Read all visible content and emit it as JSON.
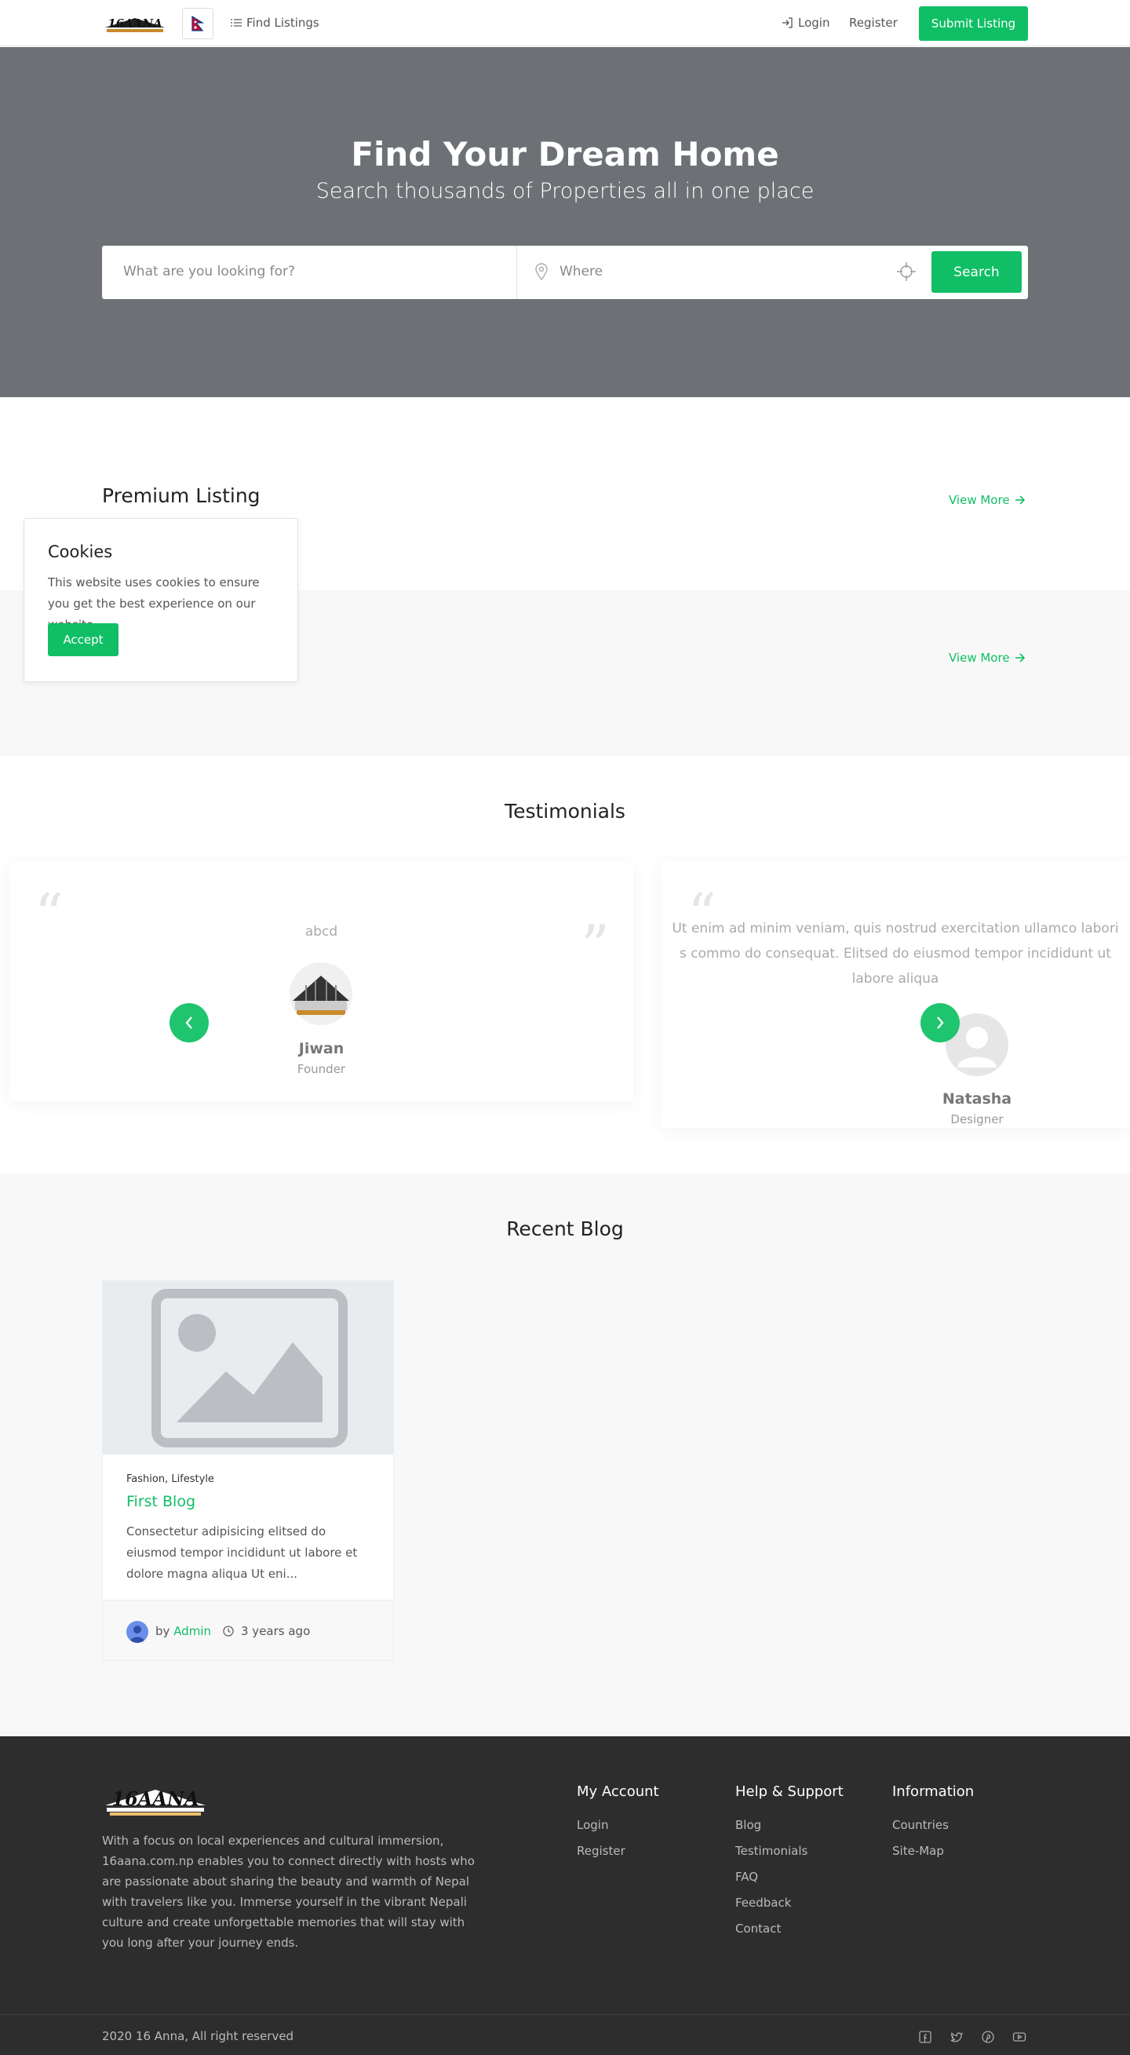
{
  "header": {
    "find_listings": "Find Listings",
    "login": "Login",
    "register": "Register",
    "submit_listing": "Submit Listing"
  },
  "hero": {
    "title": "Find Your Dream Home",
    "subtitle": "Search thousands of Properties all in one place",
    "search_placeholder": "What are you looking for?",
    "where_placeholder": "Where",
    "search_button": "Search"
  },
  "premium": {
    "title": "Premium Listing",
    "view_more": "View More"
  },
  "second_section": {
    "view_more": "View More"
  },
  "cookie": {
    "title": "Cookies",
    "text": "This website uses cookies to ensure you get the best experience on our website.",
    "accept": "Accept"
  },
  "testimonials": {
    "title": "Testimonials",
    "items": [
      {
        "text": "abcd",
        "name": "Jiwan",
        "role": "Founder"
      },
      {
        "text": "Ut enim ad minim veniam, quis nostrud exerc​itation ullamco labori​s commo do consequat. Elitsed do eiusmod tempor incididunt ut labore aliqua",
        "name": "Natasha",
        "role": "Designer"
      }
    ]
  },
  "blog": {
    "title": "Recent Blog",
    "post": {
      "categories": "Fashion, Lifestyle",
      "title": "First Blog",
      "excerpt": "Consectetur adipisicing elitsed do eiusmod tempor incididunt ut labore et dolore magna aliqua Ut eni...",
      "by": "by",
      "author": "Admin",
      "time": "3 years ago"
    }
  },
  "footer": {
    "about": "With a focus on local experiences and cultural immersion, 16aana.com.np enables you to connect directly with hosts who are passionate about sharing the beauty and warmth of Nepal with travelers like you. Immerse yourself in the vibrant Nepali culture and create unforgettable memories that will stay with you long after your journey ends.",
    "columns": [
      {
        "title": "My Account",
        "links": [
          "Login",
          "Register"
        ]
      },
      {
        "title": "Help & Support",
        "links": [
          "Blog",
          "Testimonials",
          "FAQ",
          "Feedback",
          "Contact"
        ]
      },
      {
        "title": "Information",
        "links": [
          "Countries",
          "Site-Map"
        ]
      }
    ],
    "copyright": "2020 16 Anna, All right reserved",
    "logo_text": "16AANA"
  },
  "colors": {
    "accent": "#10bf65",
    "hero_bg": "#6d7175",
    "footer_bg": "#2d2d2d"
  },
  "icons": [
    "list-icon",
    "login-icon",
    "map-pin-icon",
    "crosshair-icon",
    "arrow-right-icon",
    "chevron-left-icon",
    "chevron-right-icon",
    "clock-icon",
    "facebook-icon",
    "twitter-icon",
    "pinterest-icon",
    "youtube-icon",
    "nepal-flag-icon"
  ]
}
